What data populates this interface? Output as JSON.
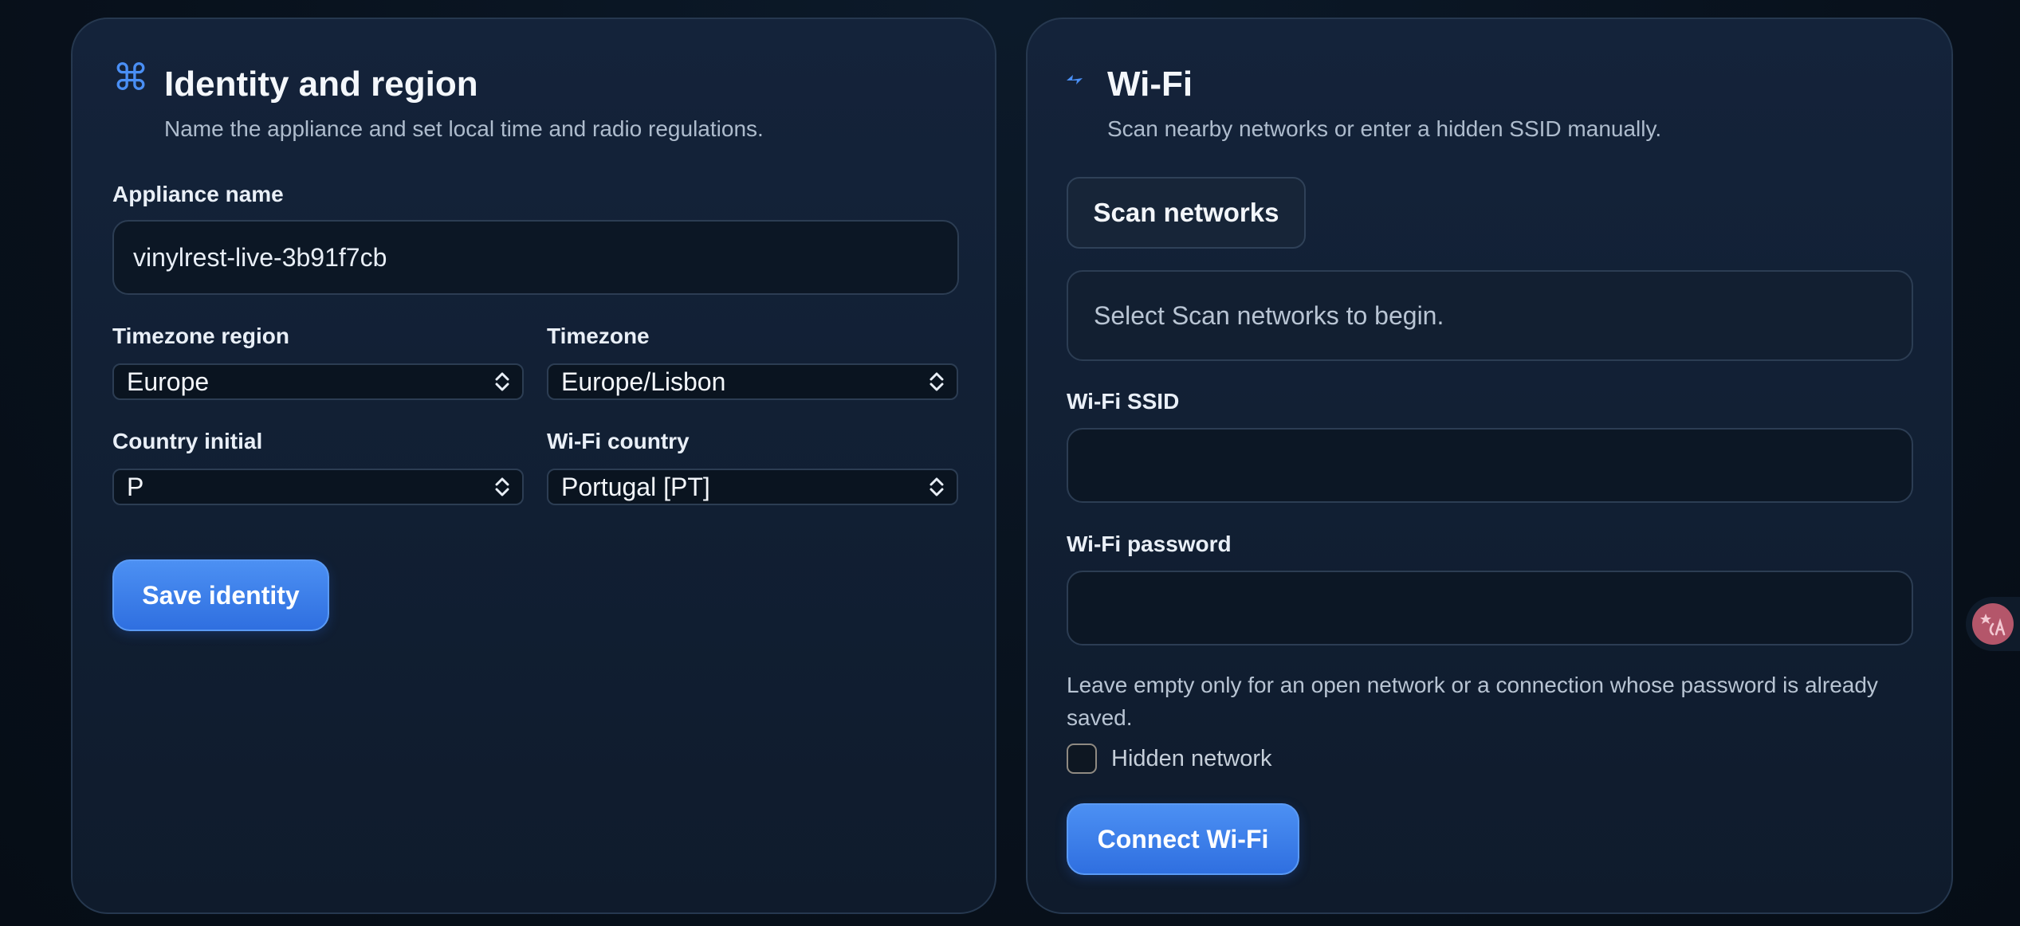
{
  "identity": {
    "icon": "command-icon",
    "title": "Identity and region",
    "subtitle": "Name the appliance and set local time and radio regulations.",
    "appliance_name_label": "Appliance name",
    "appliance_name_value": "vinylrest-live-3b91f7cb",
    "timezone_region_label": "Timezone region",
    "timezone_region_value": "Europe",
    "timezone_label": "Timezone",
    "timezone_value": "Europe/Lisbon",
    "country_initial_label": "Country initial",
    "country_initial_value": "P",
    "wifi_country_label": "Wi-Fi country",
    "wifi_country_value": "Portugal [PT]",
    "save_label": "Save identity"
  },
  "wifi": {
    "icon": "bolt-icon",
    "title": "Wi-Fi",
    "subtitle": "Scan nearby networks or enter a hidden SSID manually.",
    "scan_label": "Scan networks",
    "scan_results_text": "Select Scan networks to begin.",
    "ssid_label": "Wi-Fi SSID",
    "ssid_value": "",
    "password_label": "Wi-Fi password",
    "password_value": "",
    "password_hint": "Leave empty only for an open network or a connection whose password is already saved.",
    "hidden_label": "Hidden network",
    "hidden_checked": false,
    "connect_label": "Connect Wi-Fi"
  },
  "colors": {
    "accent": "#3b82f6",
    "card_bg": "#13223a",
    "page_bg": "#08111c"
  },
  "side_badge": {
    "icon": "translate-icon"
  }
}
